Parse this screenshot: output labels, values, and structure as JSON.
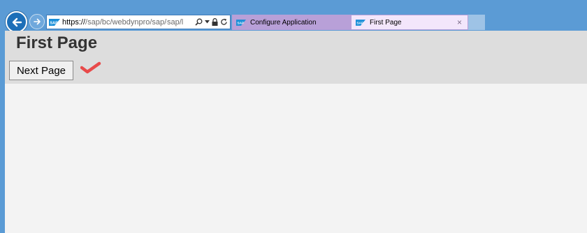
{
  "browser": {
    "address": {
      "scheme": "https://",
      "path": "/sap/bc/webdynpro/sap/cc",
      "overflow_text": "sap/l"
    },
    "tabs": [
      {
        "label": "Configure Application",
        "active": false
      },
      {
        "label": "First Page",
        "active": true,
        "close": "×"
      }
    ]
  },
  "page": {
    "title": "First Page",
    "next_button_label": "Next Page"
  },
  "colors": {
    "chrome": "#5b9bd5",
    "header_band": "#dddddd",
    "content_bg": "#f3f3f3",
    "check": "#e84a4a"
  },
  "icons": [
    "back-arrow-icon",
    "forward-arrow-icon",
    "sap-favicon-icon",
    "search-icon",
    "dropdown-caret-icon",
    "lock-icon",
    "refresh-icon",
    "close-icon",
    "checkmark-icon"
  ]
}
